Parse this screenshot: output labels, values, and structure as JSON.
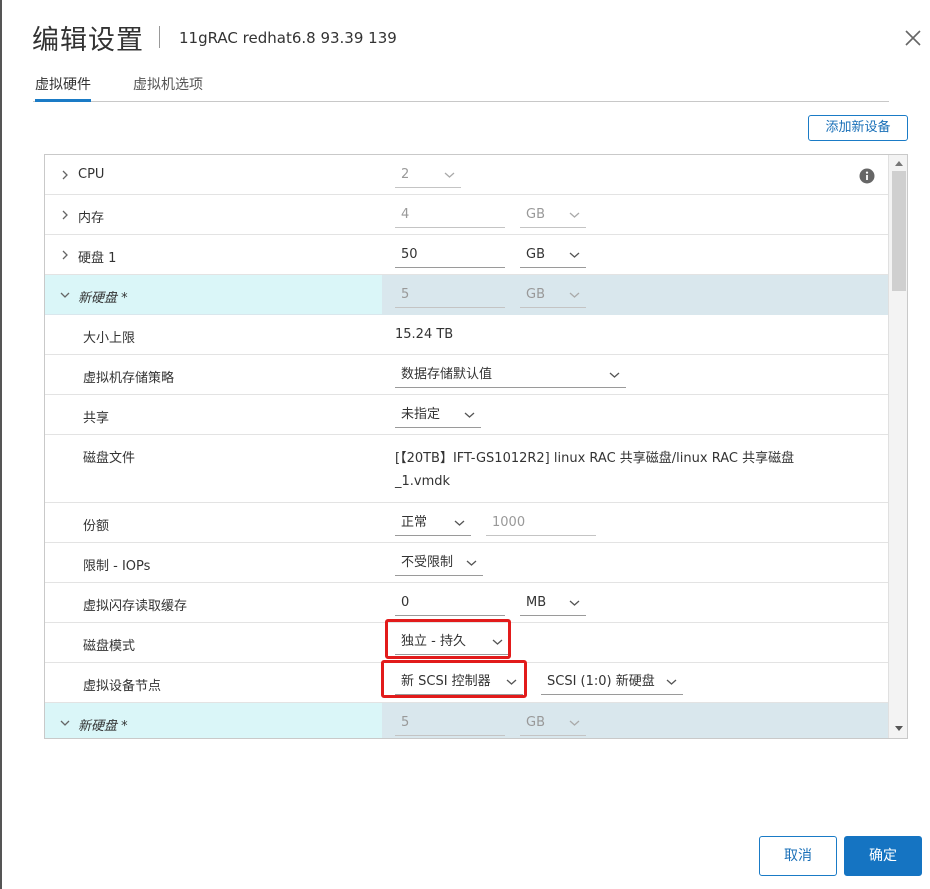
{
  "header": {
    "title": "编辑设置",
    "subtitle": "11gRAC redhat6.8 93.39 139"
  },
  "tabs": [
    {
      "label": "虚拟硬件"
    },
    {
      "label": "虚拟机选项"
    }
  ],
  "add_device_label": "添加新设备",
  "rows": {
    "cpu": {
      "label": "CPU",
      "value": "2"
    },
    "memory": {
      "label": "内存",
      "value": "4",
      "unit": "GB"
    },
    "disk1": {
      "label": "硬盘 1",
      "value": "50",
      "unit": "GB"
    },
    "newdisk": {
      "label": "新硬盘 *",
      "value": "5",
      "unit": "GB"
    },
    "max_size": {
      "label": "大小上限",
      "value": "15.24 TB"
    },
    "policy": {
      "label": "虚拟机存储策略",
      "value": "数据存储默认值"
    },
    "share": {
      "label": "共享",
      "value": "未指定"
    },
    "disk_file": {
      "label": "磁盘文件",
      "line1": "[【20TB】IFT-GS1012R2] linux RAC 共享磁盘/linux RAC 共享磁盘",
      "line2": "_1.vmdk"
    },
    "shares": {
      "label": "份额",
      "value": "正常",
      "number": "1000"
    },
    "limit_iops": {
      "label": "限制 - IOPs",
      "value": "不受限制"
    },
    "flash_cache": {
      "label": "虚拟闪存读取缓存",
      "value": "0",
      "unit": "MB"
    },
    "disk_mode": {
      "label": "磁盘模式",
      "value": "独立 - 持久"
    },
    "device_node": {
      "label": "虚拟设备节点",
      "controller": "新 SCSI 控制器",
      "node": "SCSI (1:0) 新硬盘"
    },
    "newdisk2": {
      "label": "新硬盘 *",
      "value": "5",
      "unit": "GB"
    }
  },
  "footer": {
    "cancel": "取消",
    "ok": "确定"
  },
  "colors": {
    "accent": "#1574c2",
    "highlight": "#e21b1b"
  },
  "icons": [
    "close-icon",
    "chevron-right-icon",
    "chevron-down-icon",
    "info-icon",
    "dropdown-caret-icon"
  ]
}
